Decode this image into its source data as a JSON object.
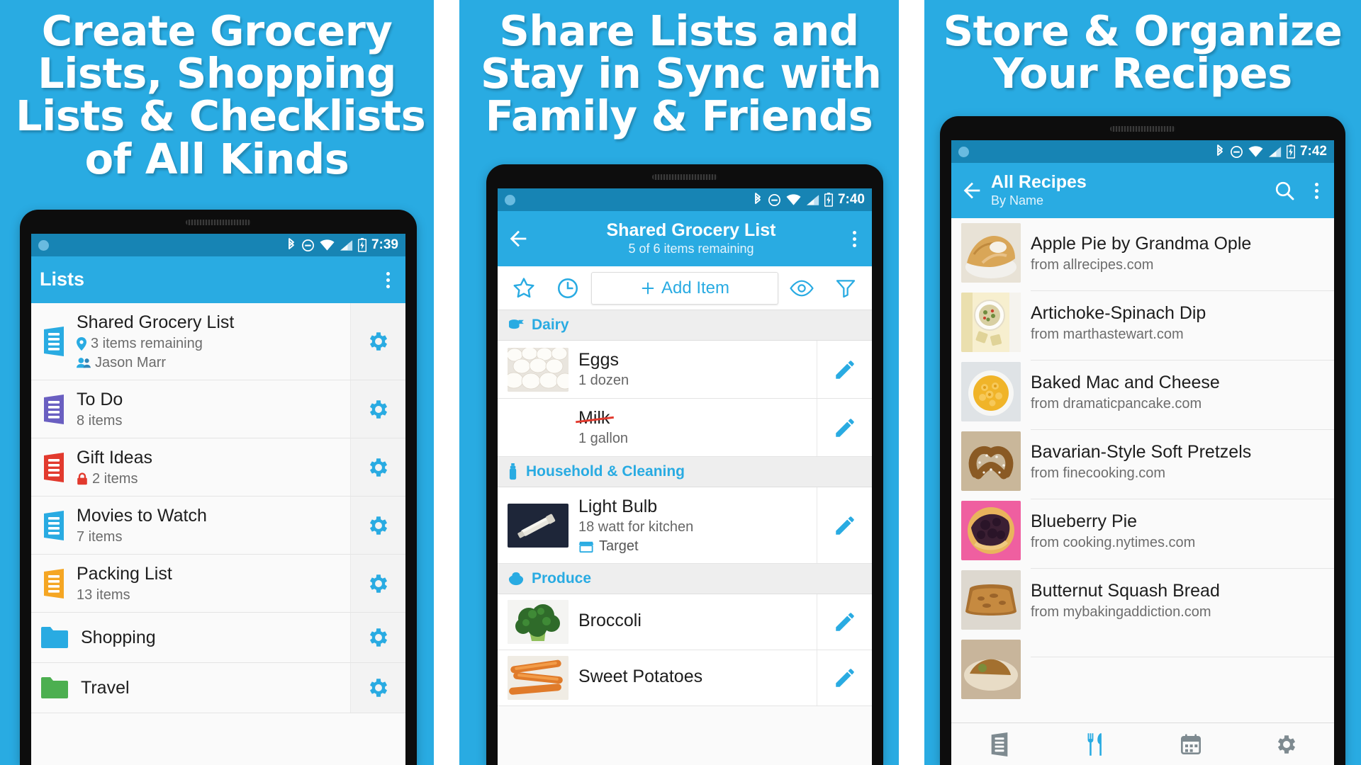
{
  "brand": {
    "accent": "#29ABE2",
    "accent_dark": "#1784B4",
    "red": "#E23A2E",
    "purple": "#6A5FC1"
  },
  "panels": [
    {
      "headline": [
        "Create Grocery",
        "Lists, Shopping",
        "Lists & Checklists",
        "of All Kinds"
      ],
      "status": {
        "time": "7:39",
        "icons": [
          "bluetooth-icon",
          "do-not-disturb-icon",
          "wifi-icon",
          "signal-icon",
          "battery-icon"
        ]
      },
      "appbar": {
        "title": "Lists",
        "overflow": "kebab-menu-icon"
      },
      "lists": [
        {
          "name": "Shared Grocery List",
          "meta": "3 items remaining",
          "meta_icon": "location-pin-icon",
          "shared_with": "Jason Marr",
          "shared_icon": "people-icon",
          "color": "#29ABE2"
        },
        {
          "name": "To Do",
          "meta": "8 items",
          "meta_icon": "",
          "shared_with": "",
          "color": "#6A5FC1"
        },
        {
          "name": "Gift Ideas",
          "meta": "2 items",
          "meta_icon": "lock-icon",
          "shared_with": "",
          "color": "#E23A2E"
        },
        {
          "name": "Movies to Watch",
          "meta": "7 items",
          "meta_icon": "",
          "shared_with": "",
          "color": "#29ABE2"
        },
        {
          "name": "Packing List",
          "meta": "13 items",
          "meta_icon": "",
          "shared_with": "",
          "color": "#F5A623"
        },
        {
          "name": "Shopping",
          "meta": "",
          "meta_icon": "",
          "shared_with": "",
          "color": "#29ABE2",
          "kind": "folder"
        },
        {
          "name": "Travel",
          "meta": "",
          "meta_icon": "",
          "shared_with": "",
          "color": "#4CAF50",
          "kind": "folder"
        }
      ],
      "row_action_icon": "gear-icon"
    },
    {
      "headline": [
        "Share Lists and",
        "Stay in Sync with",
        "Family & Friends"
      ],
      "status": {
        "time": "7:40"
      },
      "appbar": {
        "title": "Shared Grocery List",
        "subtitle": "5 of 6 items remaining",
        "back": "back-arrow-icon",
        "overflow": "kebab-menu-icon"
      },
      "toolbar": {
        "star": "star-icon",
        "clock": "clock-icon",
        "add_label": "Add Item",
        "add_plus": "plus-icon",
        "eye": "eye-icon",
        "filter": "filter-icon"
      },
      "categories": [
        {
          "name": "Dairy",
          "icon": "dairy-icon",
          "items": [
            {
              "name": "Eggs",
              "detail": "1 dozen",
              "store": "",
              "crossed": false,
              "thumb": "eggs-photo"
            },
            {
              "name": "Milk",
              "detail": "1 gallon",
              "store": "",
              "crossed": true,
              "thumb": ""
            }
          ]
        },
        {
          "name": "Household & Cleaning",
          "icon": "spray-bottle-icon",
          "items": [
            {
              "name": "Light Bulb",
              "detail": "18 watt for kitchen",
              "store": "Target",
              "store_icon": "store-icon",
              "crossed": false,
              "thumb": "lightbulb-photo"
            }
          ]
        },
        {
          "name": "Produce",
          "icon": "produce-icon",
          "items": [
            {
              "name": "Broccoli",
              "detail": "",
              "store": "",
              "crossed": false,
              "thumb": "broccoli-photo"
            },
            {
              "name": "Sweet Potatoes",
              "detail": "",
              "store": "",
              "crossed": false,
              "thumb": "sweet-potato-photo"
            }
          ]
        }
      ],
      "row_action_icon": "pencil-icon"
    },
    {
      "headline": [
        "Store & Organize",
        "Your Recipes"
      ],
      "status": {
        "time": "7:42"
      },
      "appbar": {
        "title": "All Recipes",
        "subtitle": "By Name",
        "back": "back-arrow-icon",
        "search": "search-icon",
        "overflow": "kebab-menu-icon"
      },
      "recipes": [
        {
          "title": "Apple Pie by Grandma Ople",
          "source": "from allrecipes.com",
          "thumb": "apple-pie-photo"
        },
        {
          "title": "Artichoke-Spinach Dip",
          "source": "from marthastewart.com",
          "thumb": "artichoke-dip-photo"
        },
        {
          "title": "Baked Mac and Cheese",
          "source": "from dramaticpancake.com",
          "thumb": "mac-cheese-photo"
        },
        {
          "title": "Bavarian-Style Soft Pretzels",
          "source": "from finecooking.com",
          "thumb": "pretzel-photo"
        },
        {
          "title": "Blueberry Pie",
          "source": "from cooking.nytimes.com",
          "thumb": "blueberry-pie-photo"
        },
        {
          "title": "Butternut Squash Bread",
          "source": "from mybakingaddiction.com",
          "thumb": "squash-bread-photo"
        },
        {
          "title": "",
          "source": "",
          "thumb": "partial-photo"
        }
      ],
      "bottomnav": [
        {
          "name": "lists-tab",
          "icon": "list-icon"
        },
        {
          "name": "recipes-tab",
          "icon": "fork-knife-icon"
        },
        {
          "name": "meal-plan-tab",
          "icon": "calendar-icon"
        },
        {
          "name": "settings-tab",
          "icon": "gear-icon"
        }
      ]
    }
  ]
}
